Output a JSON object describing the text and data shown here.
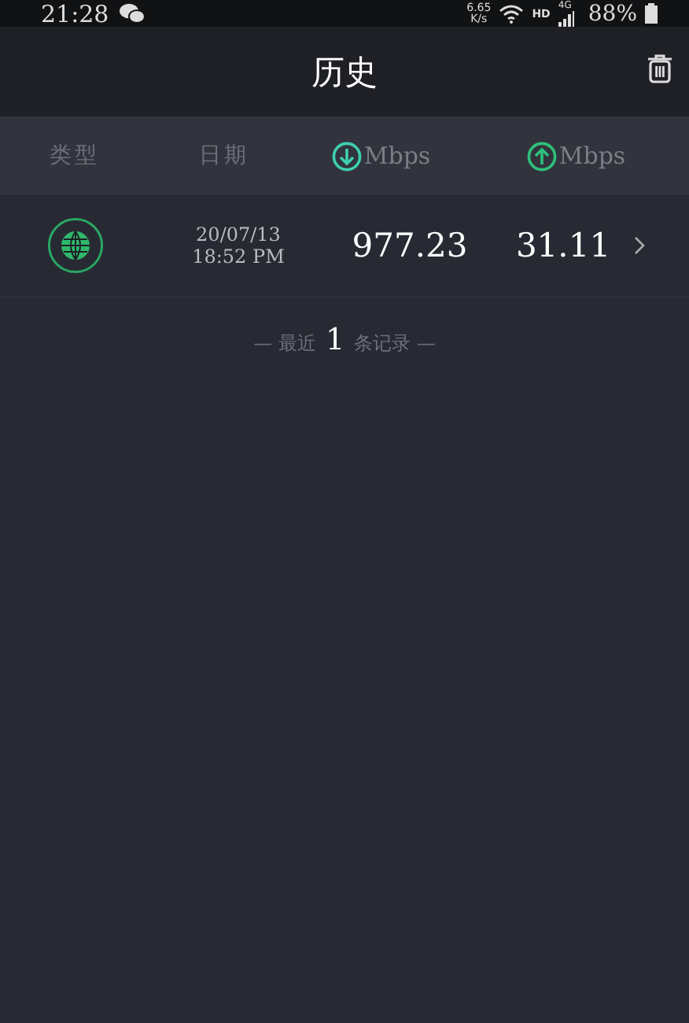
{
  "status_bar": {
    "time": "21:28",
    "net_speed_value": "6.65",
    "net_speed_unit": "K/s",
    "hd": "HD",
    "network": "4G",
    "battery": "88%"
  },
  "header": {
    "title": "历史"
  },
  "columns": [
    {
      "kind": "text",
      "label": "类型"
    },
    {
      "kind": "text",
      "label": "日期"
    },
    {
      "kind": "download",
      "label": "Mbps"
    },
    {
      "kind": "upload",
      "label": "Mbps"
    }
  ],
  "rows": [
    {
      "date": "20/07/13",
      "time": "18:52 PM",
      "download": "977.23",
      "upload": "31.11"
    }
  ],
  "footer": {
    "prefix": "— 最近",
    "count": "1",
    "suffix": "条记录 —"
  }
}
